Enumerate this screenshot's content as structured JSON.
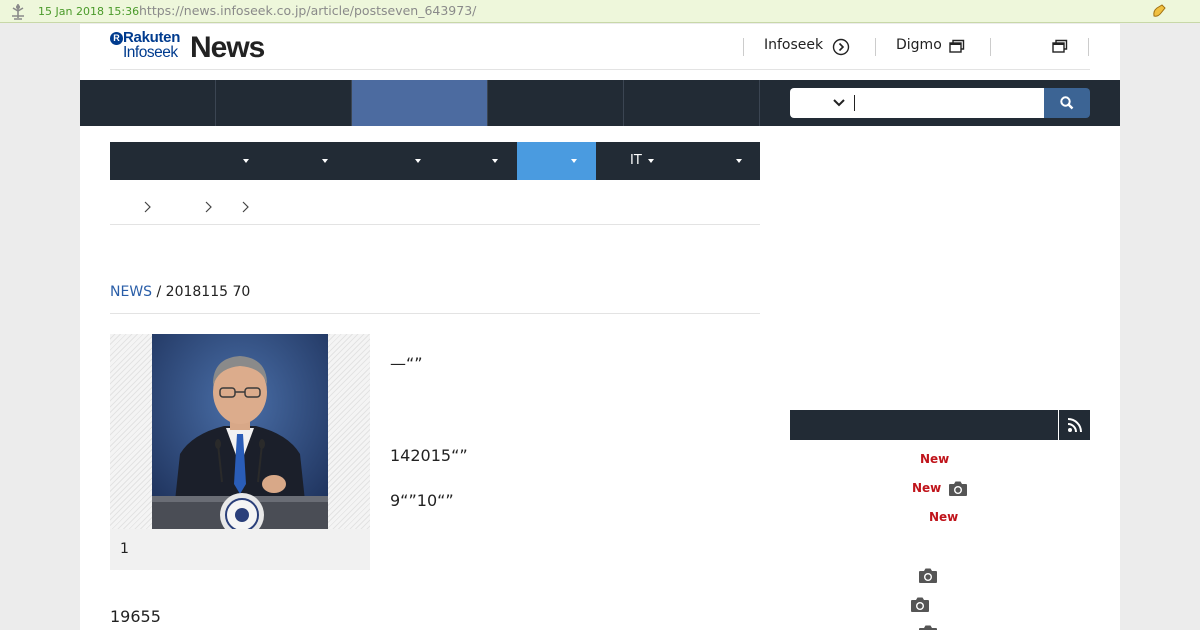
{
  "archive": {
    "date": "15 Jan 2018 15:36",
    "url": "https://news.infoseek.co.jp/article/postseven_643973/"
  },
  "header": {
    "logo_rakuten": "Rakuten",
    "logo_infoseek": "Infoseek",
    "logo_news": "News",
    "links": [
      {
        "label": "Infoseek",
        "icon": "arrow-circle-icon"
      },
      {
        "label": "Digmo",
        "icon": "external-window-icon"
      },
      {
        "label": "",
        "icon": "external-window-icon"
      }
    ]
  },
  "search": {
    "value": ""
  },
  "category_bar": {
    "items": [
      {
        "label": "",
        "active": false
      },
      {
        "label": "",
        "active": false
      },
      {
        "label": "",
        "active": false
      },
      {
        "label": "",
        "active": false
      },
      {
        "label": "",
        "active": true
      },
      {
        "label": "IT",
        "active": false
      },
      {
        "label": "",
        "active": false
      }
    ]
  },
  "article": {
    "source": "NEWS",
    "meta_suffix": " / 2018115 70",
    "lead": "—“”",
    "para1": "142015“”",
    "para2": "9“”10“”",
    "caption": "1",
    "para3": "19655"
  },
  "sidebar": {
    "new_label": "New"
  },
  "colors": {
    "nav_dark": "#222b35",
    "nav_active": "#4c6ba0",
    "category_active": "#4a9be0",
    "search_button": "#3c6494",
    "new_badge": "#c0141b",
    "source_link": "#2a5ea8"
  }
}
